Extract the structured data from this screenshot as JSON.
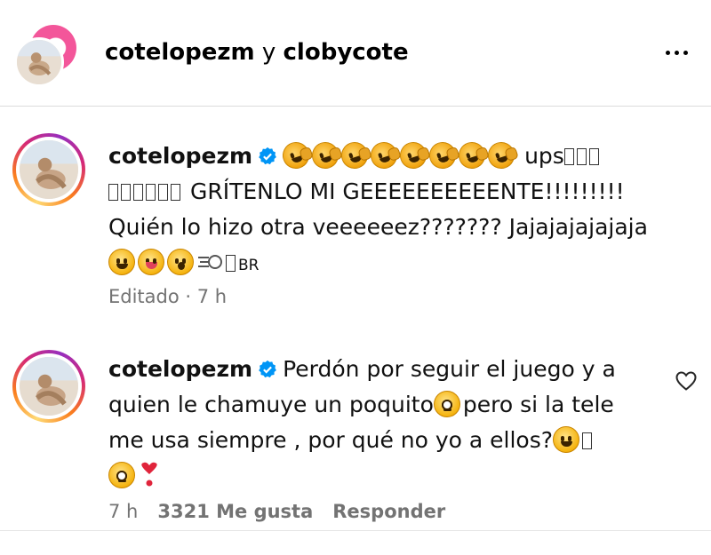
{
  "header": {
    "title_user1": "cotelopezm",
    "title_join": " y ",
    "title_user2": "clobycote",
    "avatar_icon": "collab-avatars",
    "more_icon": "more-horizontal-icon"
  },
  "comments": [
    {
      "username": "cotelopezm",
      "verified": true,
      "line1_suffix": "ups",
      "line2_text": " GRÍTENLO MI GEEEEEEEEEENTE!!!!!!!!!",
      "line3_text": "Quién lo hizo otra veeeeeez??????? Jajajajajajaja",
      "line4_tail": "BR",
      "meta": "Editado · 7 h"
    },
    {
      "username": "cotelopezm",
      "verified": true,
      "line1_text": "Perdón por seguir el juego y a",
      "line2_text_a": "quien le chamuye un poquito",
      "line2_text_b": "pero si la tele",
      "line3_text": "me usa siempre , por qué no yo a ellos?",
      "meta_time": "7 h",
      "meta_likes": "3321 Me gusta",
      "meta_reply": "Responder",
      "like_icon": "heart-outline-icon"
    }
  ],
  "colors": {
    "verified": "#0095f6",
    "meta_text": "#737373",
    "pink_avatar": "#f3569a"
  }
}
